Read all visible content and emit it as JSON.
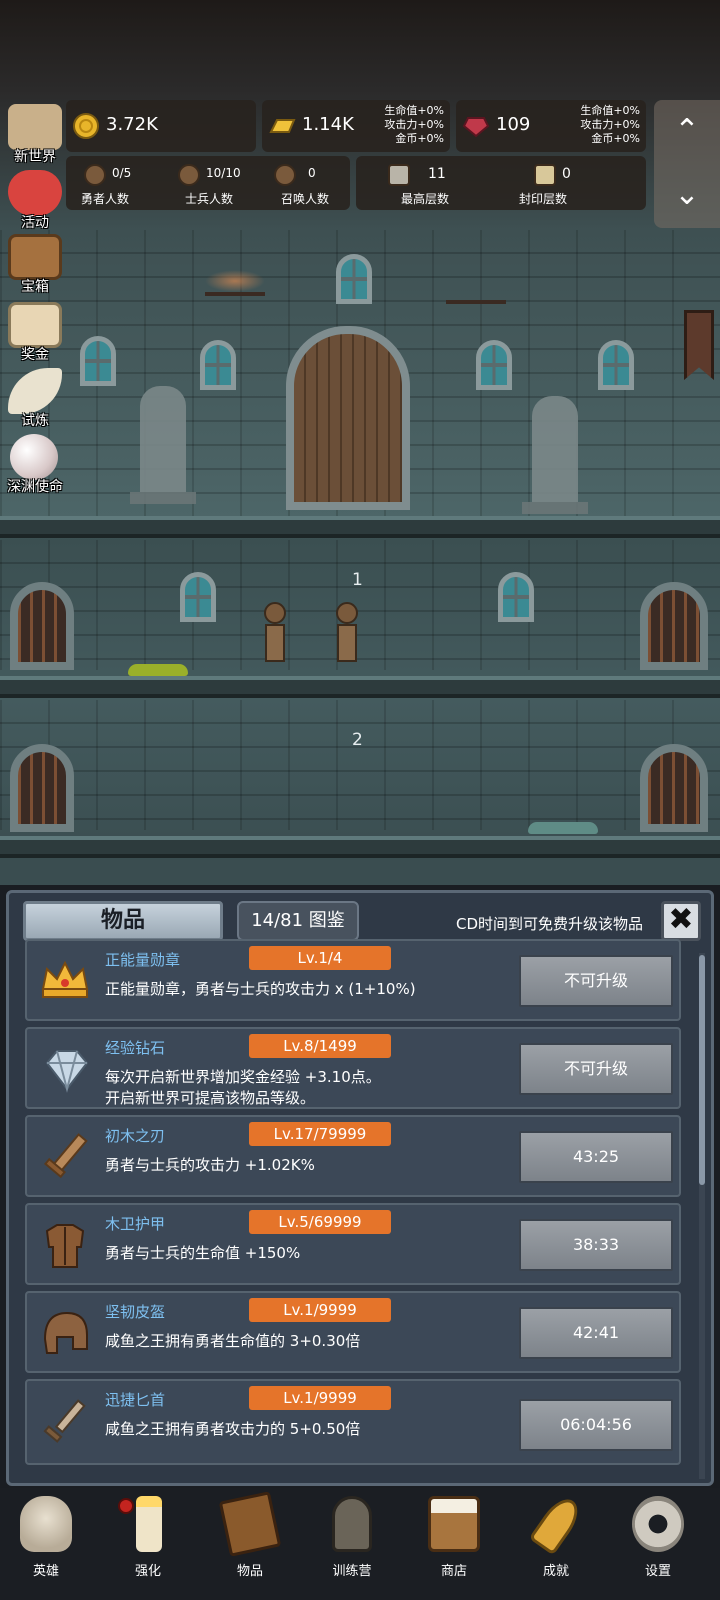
{
  "resources": {
    "gold": {
      "value": "3.72K",
      "icon": "gold-coin-icon"
    },
    "bar": {
      "value": "1.14K",
      "icon": "gold-bar-icon",
      "bonus": [
        "生命值+0%",
        "攻击力+0%",
        "金币+0%"
      ]
    },
    "gem": {
      "value": "109",
      "icon": "ruby-icon",
      "bonus": [
        "生命值+0%",
        "攻击力+0%",
        "金币+0%"
      ]
    }
  },
  "counts": [
    {
      "value": "0/5",
      "label": "勇者人数"
    },
    {
      "value": "10/10",
      "label": "士兵人数"
    },
    {
      "value": "0",
      "label": "召唤人数"
    },
    {
      "value": "11",
      "label": "最高层数"
    },
    {
      "value": "0",
      "label": "封印层数"
    }
  ],
  "arrows": {
    "up": "⌃",
    "down": "⌄"
  },
  "side_menu": [
    {
      "label": "新世界",
      "icon": "map-icon",
      "color": "#c9b08a"
    },
    {
      "label": "活动",
      "icon": "heart-icon",
      "color": "#d9443f"
    },
    {
      "label": "宝箱",
      "icon": "chest-icon",
      "color": "#a5713f"
    },
    {
      "label": "奖金",
      "icon": "envelope-icon",
      "color": "#e8d6b4"
    },
    {
      "label": "试炼",
      "icon": "feather-icon",
      "color": "#e9e2cf"
    },
    {
      "label": "深渊使命",
      "icon": "pearl-icon",
      "color": "#e8dede"
    }
  ],
  "scene": {
    "floor_labels": [
      "1",
      "2"
    ]
  },
  "panel": {
    "title": "物品",
    "count": "14/81 图鉴",
    "hint": "CD时间到可免费升级该物品",
    "close": "✖"
  },
  "items": [
    {
      "name": "正能量勋章",
      "level": "Lv.1/4",
      "desc": [
        "正能量勋章，勇者与士兵的攻击力 x (1+10%)"
      ],
      "button": "不可升级",
      "icon": "crown-medal-icon"
    },
    {
      "name": "经验钻石",
      "level": "Lv.8/1499",
      "desc": [
        "每次开启新世界增加奖金经验 +3.10点。",
        "开启新世界可提高该物品等级。"
      ],
      "button": "不可升级",
      "icon": "diamond-icon"
    },
    {
      "name": "初木之刃",
      "level": "Lv.17/79999",
      "desc": [
        "勇者与士兵的攻击力 +1.02K%"
      ],
      "button": "43:25",
      "icon": "wooden-sword-icon"
    },
    {
      "name": "木卫护甲",
      "level": "Lv.5/69999",
      "desc": [
        "勇者与士兵的生命值 +150%"
      ],
      "button": "38:33",
      "icon": "leather-armor-icon"
    },
    {
      "name": "坚韧皮盔",
      "level": "Lv.1/9999",
      "desc": [
        "咸鱼之王拥有勇者生命值的 3+0.30倍"
      ],
      "button": "42:41",
      "icon": "leather-helmet-icon"
    },
    {
      "name": "迅捷匕首",
      "level": "Lv.1/9999",
      "desc": [
        "咸鱼之王拥有勇者攻击力的 5+0.50倍"
      ],
      "button": "06:04:56",
      "icon": "dagger-icon"
    }
  ],
  "bottom_nav": [
    {
      "label": "英雄",
      "icon": "skull-icon"
    },
    {
      "label": "强化",
      "icon": "candle-icon",
      "badge": true
    },
    {
      "label": "物品",
      "icon": "book-icon"
    },
    {
      "label": "训练营",
      "icon": "lantern-icon"
    },
    {
      "label": "商店",
      "icon": "beer-mug-icon"
    },
    {
      "label": "成就",
      "icon": "key-icon"
    },
    {
      "label": "设置",
      "icon": "gear-icon"
    }
  ]
}
